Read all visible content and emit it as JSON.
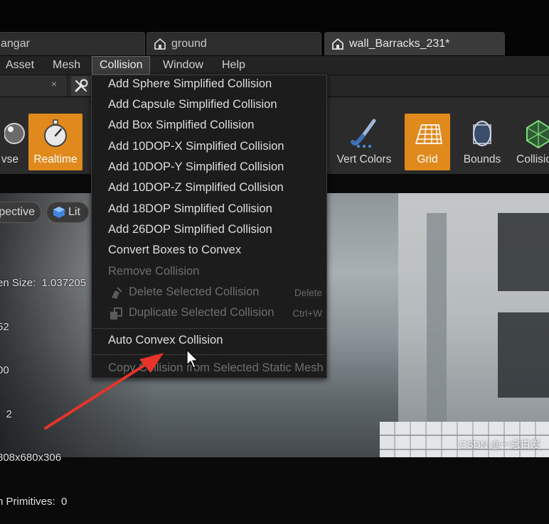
{
  "tabs": [
    {
      "label": "angar"
    },
    {
      "label": "ground"
    },
    {
      "label": "wall_Barracks_231*"
    }
  ],
  "menubar": {
    "asset": "Asset",
    "mesh": "Mesh",
    "collision": "Collision",
    "window": "Window",
    "help": "Help"
  },
  "strip": {
    "close": "×"
  },
  "toolbar": {
    "browse": "vse",
    "realtime": "Realtime",
    "vert_colors": "Vert Colors",
    "grid": "Grid",
    "bounds": "Bounds",
    "collision": "Collisio"
  },
  "viewport": {
    "perspective": "pective",
    "lit": "Lit",
    "stats": [
      "en Size:  1.037205",
      "52",
      "00",
      ":  2",
      "808x680x306",
      "n Primitives:  0"
    ]
  },
  "collision_menu": {
    "items": [
      "Add Sphere Simplified Collision",
      "Add Capsule Simplified Collision",
      "Add Box Simplified Collision",
      "Add 10DOP-X Simplified Collision",
      "Add 10DOP-Y Simplified Collision",
      "Add 10DOP-Z Simplified Collision",
      "Add 18DOP Simplified Collision",
      "Add 26DOP Simplified Collision",
      "Convert Boxes to Convex"
    ],
    "remove": "Remove Collision",
    "delete_selected": "Delete Selected Collision",
    "delete_shortcut": "Delete",
    "duplicate_selected": "Duplicate Selected Collision",
    "duplicate_shortcut": "Ctrl+W",
    "auto_convex": "Auto Convex Collision",
    "copy_from": "Copy Collision from Selected Static Mesh"
  },
  "watermark": "CSDN @一念白发",
  "colors": {
    "accent_orange": "#e08a1e",
    "menu_bg": "#1c1c1c",
    "annotation_arrow": "#e8332a"
  }
}
